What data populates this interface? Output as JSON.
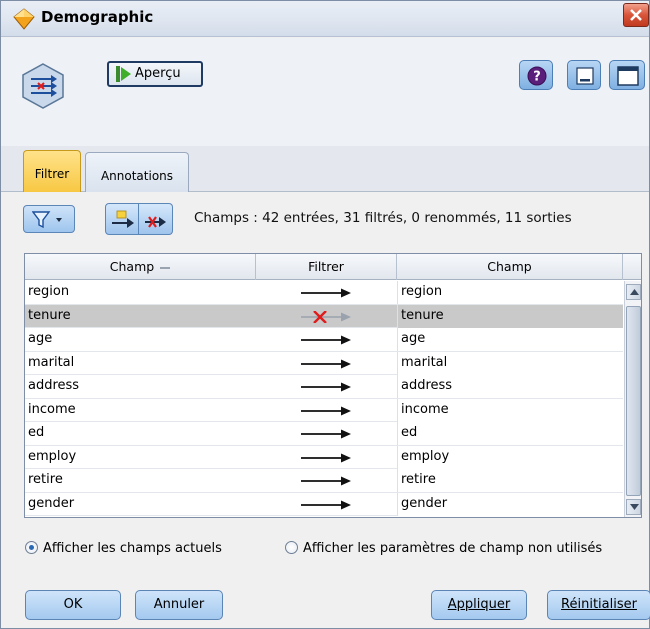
{
  "window": {
    "title": "Demographic",
    "title_icon": "diamond-node-icon",
    "close_icon": "close-icon"
  },
  "toolbar": {
    "node_icon": "filter-node-icon",
    "preview_label": "Aperçu",
    "help_icon": "help-icon",
    "minimize_icon": "minimize-icon",
    "maximize_icon": "maximize-icon"
  },
  "tabs": [
    {
      "label": "Filtrer",
      "active": true
    },
    {
      "label": "Annotations",
      "active": false
    }
  ],
  "filter_bar": {
    "funnel_icon": "funnel-menu-icon",
    "tool_icons": [
      "field-arrow-icon",
      "remove-filter-icon"
    ],
    "summary": "Champs : 42 entrées, 31 filtrés, 0 renommés, 11 sorties"
  },
  "table": {
    "columns": [
      "Champ",
      "Filtrer",
      "Champ"
    ],
    "rows": [
      {
        "input": "region",
        "filtered": false,
        "output": "region",
        "selected": false
      },
      {
        "input": "tenure",
        "filtered": true,
        "output": "tenure",
        "selected": true
      },
      {
        "input": "age",
        "filtered": false,
        "output": "age",
        "selected": false
      },
      {
        "input": "marital",
        "filtered": false,
        "output": "marital",
        "selected": false
      },
      {
        "input": "address",
        "filtered": false,
        "output": "address",
        "selected": false
      },
      {
        "input": "income",
        "filtered": false,
        "output": "income",
        "selected": false
      },
      {
        "input": "ed",
        "filtered": false,
        "output": "ed",
        "selected": false
      },
      {
        "input": "employ",
        "filtered": false,
        "output": "employ",
        "selected": false
      },
      {
        "input": "retire",
        "filtered": false,
        "output": "retire",
        "selected": false
      },
      {
        "input": "gender",
        "filtered": false,
        "output": "gender",
        "selected": false
      }
    ]
  },
  "radios": {
    "option1": "Afficher les champs actuels",
    "option2": "Afficher les paramètres de champ non utilisés",
    "selected": "option1"
  },
  "buttons": {
    "ok": "OK",
    "cancel": "Annuler",
    "apply": "Appliquer",
    "reset": "Réinitialiser"
  },
  "colors": {
    "active_tab": "#f7c843",
    "selected_row": "#c9c9c9",
    "filter_x": "#e01b1b",
    "button_blue": "#a4c9ef"
  }
}
